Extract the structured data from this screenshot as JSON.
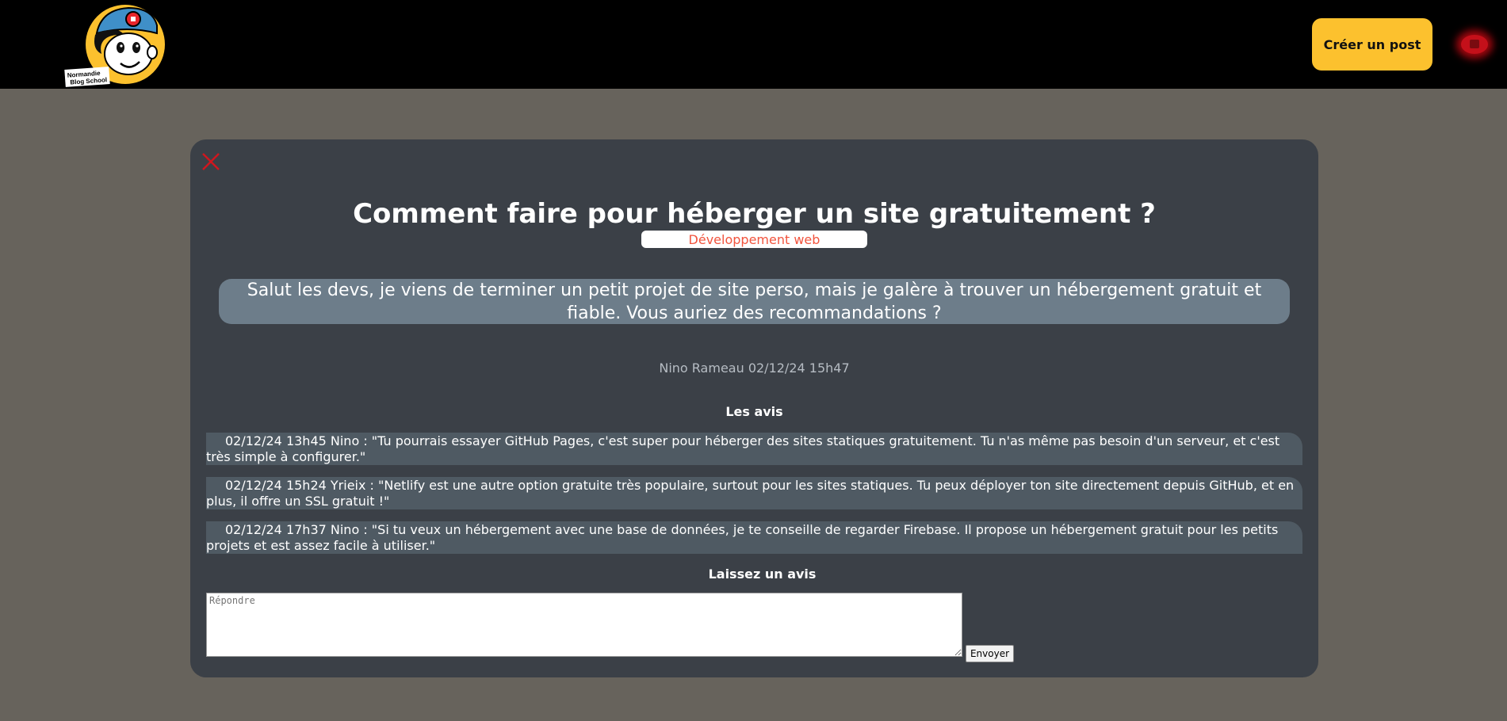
{
  "header": {
    "logo_text_line1": "Normandie",
    "logo_text_line2": "Blog School",
    "create_post_label": "Créer un post",
    "user_icon": "avatar-icon"
  },
  "post": {
    "close_icon": "close-icon",
    "title": "Comment faire pour héberger un site gratuitement ?",
    "category": "Développement web",
    "body": "Salut les devs, je viens de terminer un petit projet de site perso, mais je galère à trouver un hébergement gratuit et fiable. Vous auriez des recommandations ?",
    "meta": "Nino Rameau 02/12/24 15h47"
  },
  "reviews": {
    "heading": "Les avis",
    "items": [
      {
        "text": "02/12/24 13h45 Nino : \"Tu pourrais essayer GitHub Pages, c'est super pour héberger des sites statiques gratuitement. Tu n'as même pas besoin d'un serveur, et c'est très simple à configurer.\""
      },
      {
        "text": "02/12/24 15h24 Yrieix : \"Netlify est une autre option gratuite très populaire, surtout pour les sites statiques. Tu peux déployer ton site directement depuis GitHub, et en plus, il offre un SSL gratuit !\""
      },
      {
        "text": "02/12/24 17h37 Nino : \"Si tu veux un hébergement avec une base de données, je te conseille de regarder Firebase. Il propose un hébergement gratuit pour les petits projets et est assez facile à utiliser.\""
      }
    ]
  },
  "reply": {
    "heading": "Laissez un avis",
    "placeholder": "Répondre",
    "value": "",
    "send_label": "Envoyer"
  },
  "colors": {
    "topbar": "#000000",
    "page_background": "#67635c",
    "modal_background": "#3b4047",
    "accent_yellow": "#fcc12e",
    "category_text": "#f2543e",
    "post_body_background": "#6d7d8a",
    "review_background": "#4f5a63",
    "close_red": "#d0161e"
  }
}
